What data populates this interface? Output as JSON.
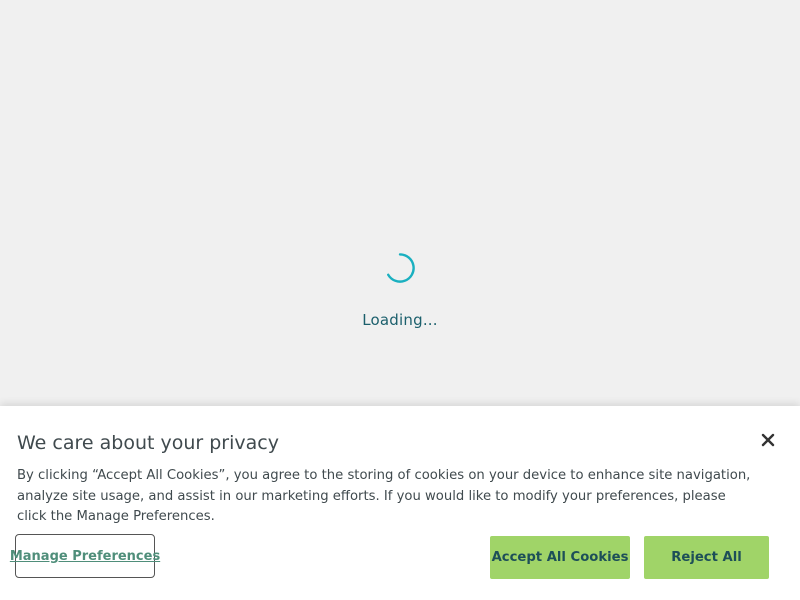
{
  "loader": {
    "text": "Loading...",
    "spinner_color": "#1ab0c0",
    "text_color": "#1b5f6c"
  },
  "cookie_banner": {
    "title": "We care about your privacy",
    "body": "By clicking “Accept All Cookies”, you agree to the storing of cookies on your device to enhance site navigation, analyze site usage, and assist in our marketing efforts. If you would like to modify your preferences, please click the Manage Preferences.",
    "manage_label": "Manage Preferences",
    "accept_label": "Accept All Cookies",
    "reject_label": "Reject All",
    "close_icon": "close-icon",
    "button_color": "#a0d468"
  }
}
